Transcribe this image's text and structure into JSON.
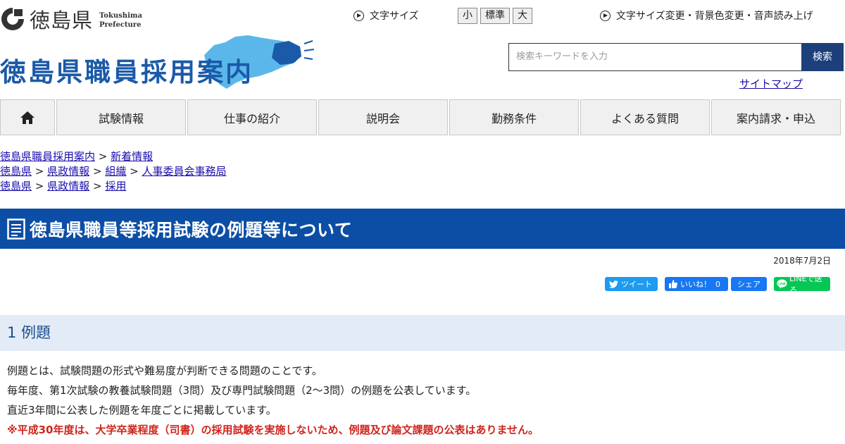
{
  "header": {
    "pref_name": "徳島県",
    "pref_name_en_1": "Tokushima",
    "pref_name_en_2": "Prefecture",
    "site_title": "徳島県職員採用案内",
    "font_size_label": "文字サイズ",
    "font_sizes": [
      "小",
      "標準",
      "大"
    ],
    "accessibility_label": "文字サイズ変更・背景色変更・音声読み上げ",
    "search_placeholder": "検索キーワードを入力",
    "search_button": "検索",
    "sitemap": "サイトマップ"
  },
  "nav": {
    "home_icon": "home-icon",
    "items": [
      "試験情報",
      "仕事の紹介",
      "説明会",
      "勤務条件",
      "よくある質問",
      "案内請求・申込"
    ]
  },
  "breadcrumbs": [
    [
      "徳島県職員採用案内",
      "新着情報"
    ],
    [
      "徳島県",
      "県政情報",
      "組織",
      "人事委員会事務局"
    ],
    [
      "徳島県",
      "県政情報",
      "採用"
    ]
  ],
  "breadcrumb_separator": ">",
  "page": {
    "title": "徳島県職員等採用試験の例題等について",
    "date": "2018年7月2日"
  },
  "social": {
    "tweet": "ツイート",
    "like": "いいね！",
    "like_count": "0",
    "share": "シェア",
    "line": "LINEで送る"
  },
  "section": {
    "heading": "1 例題",
    "lines": [
      "例題とは、試験問題の形式や難易度が判断できる問題のことです。",
      "毎年度、第1次試験の教養試験問題（3問）及び専門試験問題（2～3問）の例題を公表しています。",
      "直近3年間に公表した例題を年度ごとに掲載しています。"
    ],
    "warning": "※平成30年度は、大学卒業程度（司書）の採用試験を実施しないため、例題及び論文課題の公表はありません。"
  },
  "colors": {
    "brand_blue": "#0c4ea5",
    "search_button": "#1d3f7a",
    "section_bg": "#e3ebf6",
    "warning_red": "#d0251c"
  }
}
